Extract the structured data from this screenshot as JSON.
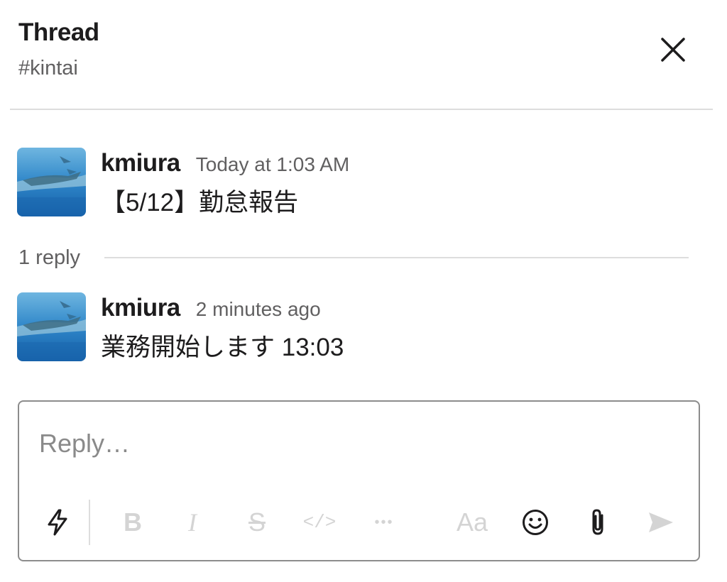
{
  "header": {
    "title": "Thread",
    "channel": "#kintai"
  },
  "parent_message": {
    "author": "kmiura",
    "timestamp": "Today at 1:03 AM",
    "text": "【5/12】勤怠報告"
  },
  "replies_summary": {
    "count_label": "1 reply"
  },
  "reply_message": {
    "author": "kmiura",
    "timestamp": "2 minutes ago",
    "text": "業務開始します 13:03"
  },
  "composer": {
    "placeholder": "Reply…",
    "toolbar": {
      "bold": "B",
      "italic": "I",
      "strike": "S",
      "code": "</>",
      "more": "•••",
      "format": "Aa"
    }
  },
  "icons": {
    "close": "close-icon",
    "shortcuts": "lightning-icon",
    "emoji": "emoji-icon",
    "attach": "paperclip-icon",
    "send": "send-icon"
  },
  "colors": {
    "text": "#1d1c1d",
    "muted": "#616061",
    "divider": "#dddddd",
    "disabled": "#d4d4d4"
  }
}
